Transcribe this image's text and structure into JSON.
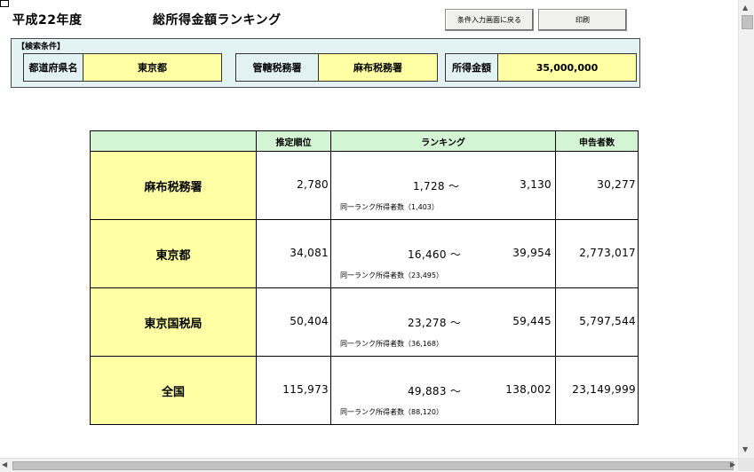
{
  "header": {
    "year_title": "平成22年度",
    "main_title": "総所得金額ランキング",
    "back_button": "条件入力画面に戻る",
    "print_button": "印刷"
  },
  "conditions": {
    "heading": "【検索条件】",
    "prefecture_label": "都道府県名",
    "prefecture_value": "東京都",
    "office_label": "管轄税務署",
    "office_value": "麻布税務署",
    "income_label": "所得金額",
    "income_value": "35,000,000"
  },
  "table": {
    "headers": {
      "blank": "",
      "estimated_rank": "推定順位",
      "ranking": "ランキング",
      "filers": "申告者数"
    },
    "tilde": "〜",
    "rows": [
      {
        "name": "麻布税務署",
        "estimated_rank": "2,780",
        "rank_from": "1,728",
        "rank_to": "3,130",
        "note": "同一ランク所得者数（1,403）",
        "filers": "30,277"
      },
      {
        "name": "東京都",
        "estimated_rank": "34,081",
        "rank_from": "16,460",
        "rank_to": "39,954",
        "note": "同一ランク所得者数（23,495）",
        "filers": "2,773,017"
      },
      {
        "name": "東京国税局",
        "estimated_rank": "50,404",
        "rank_from": "23,278",
        "rank_to": "59,445",
        "note": "同一ランク所得者数（36,168）",
        "filers": "5,797,544"
      },
      {
        "name": "全国",
        "estimated_rank": "115,973",
        "rank_from": "49,883",
        "rank_to": "138,002",
        "note": "同一ランク所得者数（88,120）",
        "filers": "23,149,999"
      }
    ]
  }
}
